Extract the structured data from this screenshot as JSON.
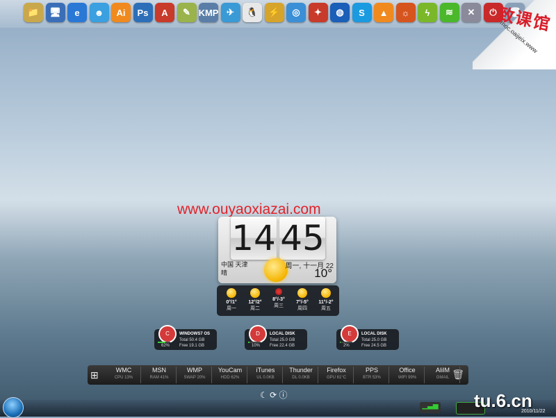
{
  "dock": {
    "icons": [
      {
        "name": "folder-icon",
        "glyph": "📁",
        "color": "#c9a84c"
      },
      {
        "name": "computer-icon",
        "glyph": "🖥",
        "color": "#3a6fb8"
      },
      {
        "name": "ie-icon",
        "glyph": "e",
        "color": "#2a78d6"
      },
      {
        "name": "messenger-icon",
        "glyph": "☻",
        "color": "#3aa0e0"
      },
      {
        "name": "illustrator-icon",
        "glyph": "Ai",
        "color": "#f08a1e"
      },
      {
        "name": "photoshop-icon",
        "glyph": "Ps",
        "color": "#2c6fb8"
      },
      {
        "name": "autocad-icon",
        "glyph": "A",
        "color": "#c83a2a"
      },
      {
        "name": "notes-icon",
        "glyph": "✎",
        "color": "#9ab34a"
      },
      {
        "name": "kmplayer-icon",
        "glyph": "KMP",
        "color": "#5a7ea8"
      },
      {
        "name": "bird-icon",
        "glyph": "✈",
        "color": "#3a9ad6"
      },
      {
        "name": "qq-icon",
        "glyph": "🐧",
        "color": "#e8e8e8"
      },
      {
        "name": "thunder-icon",
        "glyph": "⚡",
        "color": "#d6a42a"
      },
      {
        "name": "globe-icon",
        "glyph": "◎",
        "color": "#3a8fd6"
      },
      {
        "name": "tools-icon",
        "glyph": "✦",
        "color": "#c83a2a"
      },
      {
        "name": "orb-icon",
        "glyph": "◍",
        "color": "#1a5fb8"
      },
      {
        "name": "skype-icon",
        "glyph": "S",
        "color": "#1a9ae0"
      },
      {
        "name": "vlc-icon",
        "glyph": "▲",
        "color": "#f08a1e"
      },
      {
        "name": "firefox-icon",
        "glyph": "☼",
        "color": "#d6541e"
      },
      {
        "name": "flash-icon",
        "glyph": "ϟ",
        "color": "#7ab82a"
      },
      {
        "name": "wifi-icon",
        "glyph": "≋",
        "color": "#4ab82a"
      },
      {
        "name": "close-orb-icon",
        "glyph": "✕",
        "color": "#8a8a9a"
      },
      {
        "name": "power-icon",
        "glyph": "⏻",
        "color": "#c82a2a"
      },
      {
        "name": "trash-icon",
        "glyph": "🗑",
        "color": "#8aa0b8"
      }
    ]
  },
  "logo": {
    "title": "致课馆",
    "sub": "moc.oaijeix.www"
  },
  "watermark": "www.ouyaoxiazai.com",
  "clock": {
    "hour": "14",
    "minute": "45",
    "location": "中国 天津",
    "condition": "晴",
    "date": "周一, 十一月 22",
    "temperature": "10°"
  },
  "forecast": [
    {
      "temp": "0°/1°",
      "day": "周一",
      "rain": false
    },
    {
      "temp": "12°/2°",
      "day": "周二",
      "rain": false
    },
    {
      "temp": "8°/-3°",
      "day": "周三",
      "rain": true
    },
    {
      "temp": "7°/-5°",
      "day": "周四",
      "rain": false
    },
    {
      "temp": "11°/-2°",
      "day": "周五",
      "rain": false
    }
  ],
  "disks": [
    {
      "letter": "C",
      "title": "WINDOWS7 OS",
      "total": "Total 50.4 GB",
      "free": "Free 19.1 GB",
      "pct": "62%",
      "usage": 0.62
    },
    {
      "letter": "D",
      "title": "LOCAL DISK",
      "total": "Total 25.0 GB",
      "free": "Free 22.4 GB",
      "pct": "10%",
      "usage": 0.1
    },
    {
      "letter": "E",
      "title": "LOCAL DISK",
      "total": "Total 25.0 GB",
      "free": "Free 24.5 GB",
      "pct": "2%",
      "usage": 0.02
    }
  ],
  "launcher": [
    {
      "label": "WMC",
      "sub": "CPU   13%"
    },
    {
      "label": "MSN",
      "sub": "RAM   41%"
    },
    {
      "label": "WMP",
      "sub": "SWAP 20%"
    },
    {
      "label": "YouCam",
      "sub": "HDD   62%"
    },
    {
      "label": "iTunes",
      "sub": "UL   0.0KB"
    },
    {
      "label": "Thunder",
      "sub": "DL   0.0KB"
    },
    {
      "label": "Firefox",
      "sub": "GPU   61°C"
    },
    {
      "label": "PPS",
      "sub": "BTR   53%"
    },
    {
      "label": "Office",
      "sub": "WIFI  99%"
    },
    {
      "label": "AliIM",
      "sub": "GMAIL"
    }
  ],
  "tray": {
    "brand": "tu.6.cn",
    "date": "2010/11/22"
  }
}
